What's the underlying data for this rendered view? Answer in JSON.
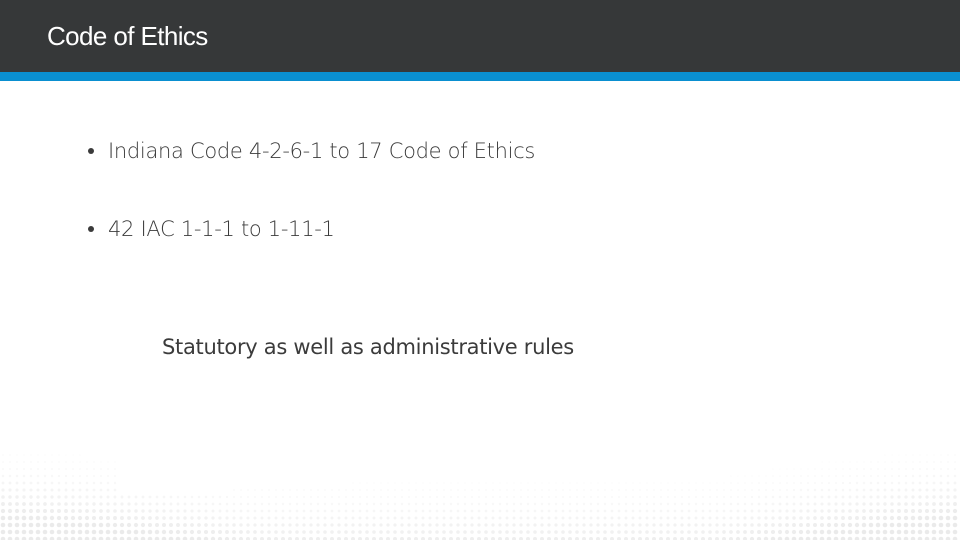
{
  "slide": {
    "title": "Code of Ethics",
    "bullets": [
      {
        "text": "Indiana Code 4-2-6-1 to 17 Code of Ethics"
      },
      {
        "text": "42 IAC 1-1-1 to 1-11-1"
      }
    ],
    "note": "Statutory as well as administrative rules"
  },
  "theme": {
    "header_color": "#363839",
    "accent_color": "#0a8fd0",
    "text_color": "#3b3b3b",
    "background_color": "#ffffff"
  },
  "decoration": {
    "icon": "halftone-dot-pattern"
  }
}
